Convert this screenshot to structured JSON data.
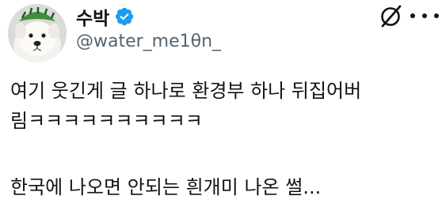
{
  "author": {
    "display_name": "수박",
    "handle": "@water_me1θn_",
    "verified": true
  },
  "header_icons": {
    "grok": "grok-slash-circle-icon",
    "more": "more-dots-icon"
  },
  "tweet": {
    "line1": "여기 웃긴게 글 하나로 환경부 하나 뒤집어버",
    "line2": "림ㅋㅋㅋㅋㅋㅋㅋㅋㅋㅋ",
    "line3": "한국에 나오면 안되는 흰개미 나온 썰..."
  },
  "colors": {
    "text_primary": "#0f1419",
    "text_secondary": "#536471",
    "verified_blue": "#1d9bf0",
    "background": "#ffffff"
  }
}
